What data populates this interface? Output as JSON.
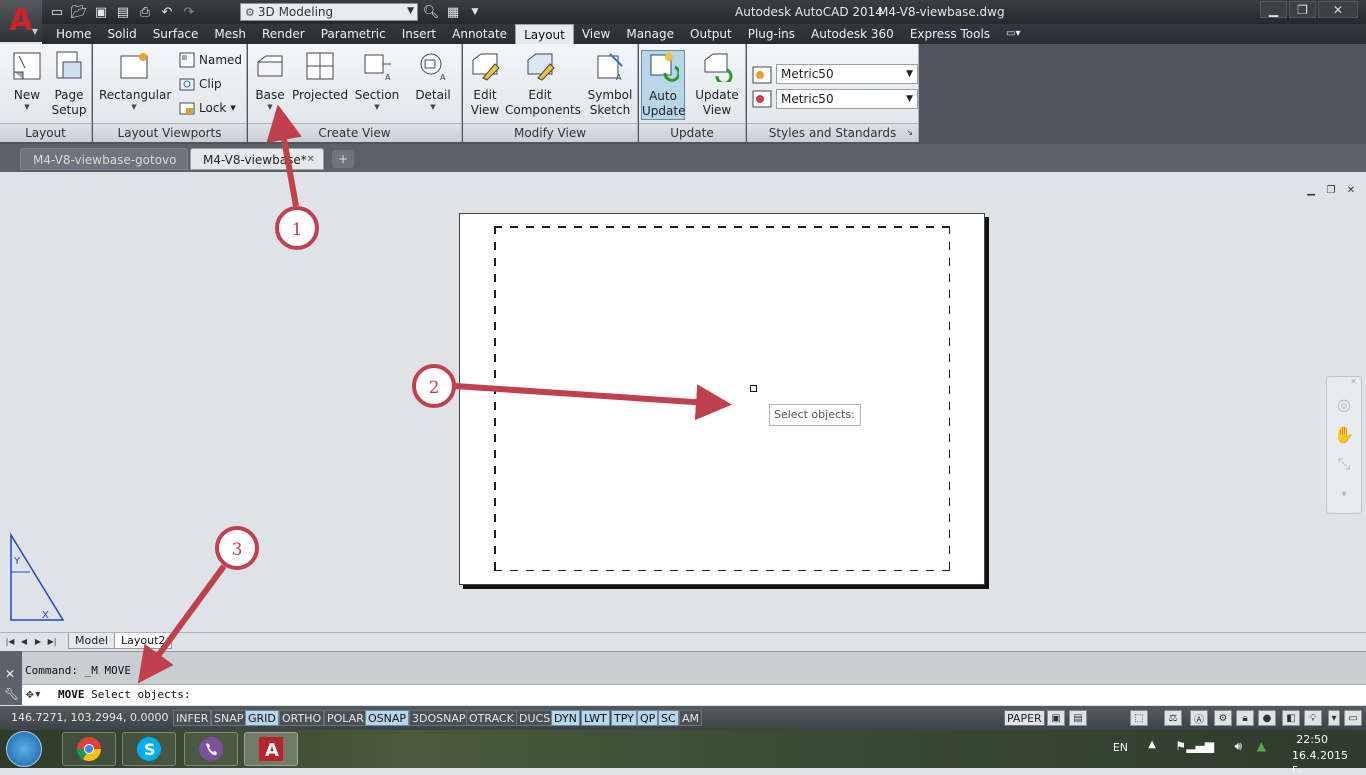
{
  "titlebar": {
    "workspace": "3D Modeling",
    "app_title": "Autodesk AutoCAD 2014",
    "doc_title": "M4-V8-viewbase.dwg"
  },
  "menu": [
    "Home",
    "Solid",
    "Surface",
    "Mesh",
    "Render",
    "Parametric",
    "Insert",
    "Annotate",
    "Layout",
    "View",
    "Manage",
    "Output",
    "Plug-ins",
    "Autodesk 360",
    "Express Tools"
  ],
  "menu_active": "Layout",
  "ribbon": {
    "layout_panel": {
      "title": "Layout",
      "new": "New",
      "page_setup_1": "Page",
      "page_setup_2": "Setup"
    },
    "viewports_panel": {
      "title": "Layout Viewports",
      "rectangular": "Rectangular",
      "named": "Named",
      "clip": "Clip",
      "lock": "Lock"
    },
    "create_view_panel": {
      "title": "Create View",
      "base": "Base",
      "projected": "Projected",
      "section": "Section",
      "detail": "Detail"
    },
    "modify_view_panel": {
      "title": "Modify View",
      "edit_view_1": "Edit",
      "edit_view_2": "View",
      "edit_components_1": "Edit",
      "edit_components_2": "Components",
      "symbol_sketch_1": "Symbol",
      "symbol_sketch_2": "Sketch"
    },
    "update_panel": {
      "title": "Update",
      "auto_update_1": "Auto",
      "auto_update_2": "Update",
      "update_view_1": "Update",
      "update_view_2": "View"
    },
    "styles_panel": {
      "title": "Styles and Standards",
      "style1": "Metric50",
      "style2": "Metric50"
    }
  },
  "doc_tabs": [
    {
      "label": "M4-V8-viewbase-gotovo"
    },
    {
      "label": "M4-V8-viewbase*"
    }
  ],
  "drawing": {
    "tooltip": "Select objects:"
  },
  "layout_tabs": {
    "model": "Model",
    "layout2": "Layout2"
  },
  "command": {
    "history": "Command: _M MOVE",
    "prompt_cmd": "MOVE",
    "prompt_text": "Select objects:"
  },
  "status": {
    "coords": "146.7271, 103.2994, 0.0000",
    "toggles": [
      {
        "label": "INFER",
        "on": false
      },
      {
        "label": "SNAP",
        "on": false
      },
      {
        "label": "GRID",
        "on": true
      },
      {
        "label": "ORTHO",
        "on": false
      },
      {
        "label": "POLAR",
        "on": false
      },
      {
        "label": "OSNAP",
        "on": true
      },
      {
        "label": "3DOSNAP",
        "on": false
      },
      {
        "label": "OTRACK",
        "on": false
      },
      {
        "label": "DUCS",
        "on": false
      },
      {
        "label": "DYN",
        "on": true
      },
      {
        "label": "LWT",
        "on": true
      },
      {
        "label": "TPY",
        "on": true
      },
      {
        "label": "QP",
        "on": true
      },
      {
        "label": "SC",
        "on": true
      },
      {
        "label": "AM",
        "on": false
      }
    ],
    "paper": "PAPER"
  },
  "annotations": [
    "1",
    "2",
    "3"
  ],
  "taskbar": {
    "lang": "EN",
    "time": "22:50",
    "date": "16.4.2015 г."
  },
  "colors": {
    "annotation": "#c0414d",
    "accent": "#b8d6ea",
    "autocad_red": "#d0202a"
  }
}
